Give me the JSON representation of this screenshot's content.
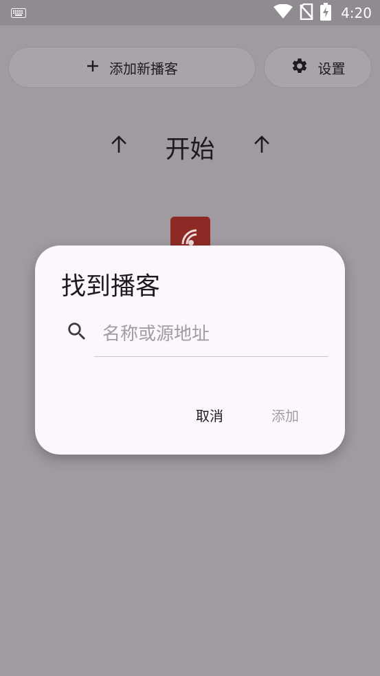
{
  "status_bar": {
    "time": "4:20"
  },
  "toolbar": {
    "add_label": "添加新播客",
    "settings_label": "设置"
  },
  "start": {
    "label": "开始"
  },
  "dialog": {
    "title": "找到播客",
    "search_placeholder": "名称或源地址",
    "search_value": "",
    "cancel_label": "取消",
    "add_label": "添加"
  },
  "colors": {
    "scrim_background": "#9f9ba1",
    "dialog_background": "#fdf7fd",
    "podcast_icon": "#8e2a26",
    "disabled_text": "#a09ca3"
  },
  "icons": [
    "keyboard-icon",
    "wifi-icon",
    "no-sim-icon",
    "battery-charging-icon",
    "plus-icon",
    "gear-icon",
    "arrow-up-icon",
    "podcast-rss-icon",
    "search-icon"
  ]
}
